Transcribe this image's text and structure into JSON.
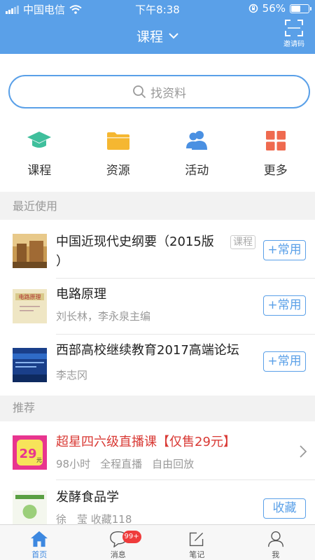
{
  "status_bar": {
    "carrier": "中国电信",
    "time": "下午8:38",
    "battery": "56%",
    "battery_level": 0.56
  },
  "header": {
    "title": "课程",
    "scan_label": "邀请码"
  },
  "search": {
    "placeholder": "找资料"
  },
  "quick_actions": [
    {
      "label": "课程",
      "icon": "graduation-cap-icon",
      "color": "#3fbf9c"
    },
    {
      "label": "资源",
      "icon": "folder-icon",
      "color": "#f5b731"
    },
    {
      "label": "活动",
      "icon": "users-icon",
      "color": "#4a90e2"
    },
    {
      "label": "更多",
      "icon": "grid-icon",
      "color": "#ef6a4f"
    }
  ],
  "recent": {
    "section_label": "最近使用",
    "items": [
      {
        "title_line1": "中国近现代史纲要（2015版",
        "title_line2": "）",
        "tag": "课程",
        "button": "+常用"
      },
      {
        "title": "电路原理",
        "subtitle": "刘长林，李永泉主编",
        "button": "+常用"
      },
      {
        "title": "西部高校继续教育2017高端论坛",
        "subtitle": "李志冈",
        "button": "+常用"
      }
    ]
  },
  "recommend": {
    "section_label": "推荐",
    "items": [
      {
        "title": "超星四六级直播课【仅售29元】",
        "meta": [
          "98小时",
          "全程直播",
          "自由回放"
        ],
        "thumb_text": "29",
        "thumb_unit": "元"
      },
      {
        "title": "发酵食品学",
        "subtitle": "徐　莹 收藏118",
        "button": "收藏"
      }
    ]
  },
  "tabbar": [
    {
      "label": "首页",
      "icon": "home-icon",
      "active": true
    },
    {
      "label": "消息",
      "icon": "chat-icon",
      "badge": "99+"
    },
    {
      "label": "笔记",
      "icon": "edit-icon"
    },
    {
      "label": "我",
      "icon": "person-icon"
    }
  ],
  "colors": {
    "brand": "#5aa0e8",
    "accent_red": "#d93a35",
    "badge": "#ef3b3b"
  }
}
